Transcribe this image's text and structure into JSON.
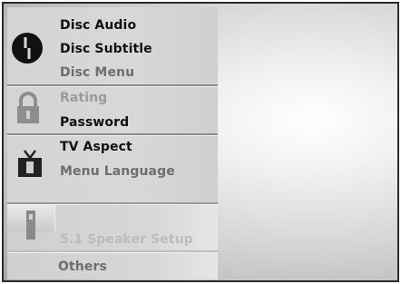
{
  "menu": {
    "disc_group": {
      "icon": "disc-icon",
      "items": [
        "Disc Audio",
        "Disc Subtitle",
        "Disc Menu"
      ]
    },
    "lock_group": {
      "icon": "padlock-icon",
      "items": [
        "Rating",
        "Password"
      ]
    },
    "tv_group": {
      "icon": "tv-icon",
      "items": [
        "TV Aspect",
        "Menu Language"
      ]
    },
    "speaker_group": {
      "icon": "speaker-icon",
      "items": [
        "5.1 Speaker Setup"
      ]
    },
    "other_group": {
      "items": [
        "Others"
      ]
    }
  }
}
